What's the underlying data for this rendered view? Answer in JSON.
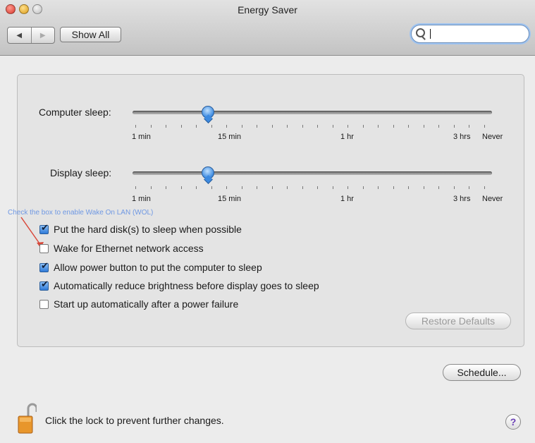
{
  "window": {
    "title": "Energy Saver"
  },
  "toolbar": {
    "back_icon": "◀",
    "forward_icon": "▶",
    "show_all_label": "Show All",
    "search_value": ""
  },
  "computer_sleep": {
    "label": "Computer sleep:",
    "value": "15 min",
    "ticks": [
      "1 min",
      "15 min",
      "1 hr",
      "3 hrs",
      "Never"
    ]
  },
  "display_sleep": {
    "label": "Display sleep:",
    "value": "15 min",
    "ticks": [
      "1 min",
      "15 min",
      "1 hr",
      "3 hrs",
      "Never"
    ]
  },
  "annotation": {
    "text": "Check the box to enable Wake On LAN (WOL)",
    "color": "#6f98e3",
    "arrow_color": "#d9483a"
  },
  "options": [
    {
      "label": "Put the hard disk(s) to sleep when possible",
      "checked": true
    },
    {
      "label": "Wake for Ethernet network access",
      "checked": false
    },
    {
      "label": "Allow power button to put the computer to sleep",
      "checked": true
    },
    {
      "label": "Automatically reduce brightness before display goes to sleep",
      "checked": true
    },
    {
      "label": "Start up automatically after a power failure",
      "checked": false
    }
  ],
  "buttons": {
    "restore_defaults": "Restore Defaults",
    "schedule": "Schedule..."
  },
  "footer": {
    "lock_text": "Click the lock to prevent further changes.",
    "help_label": "?"
  },
  "colors": {
    "accent": "#3c8ae0"
  }
}
